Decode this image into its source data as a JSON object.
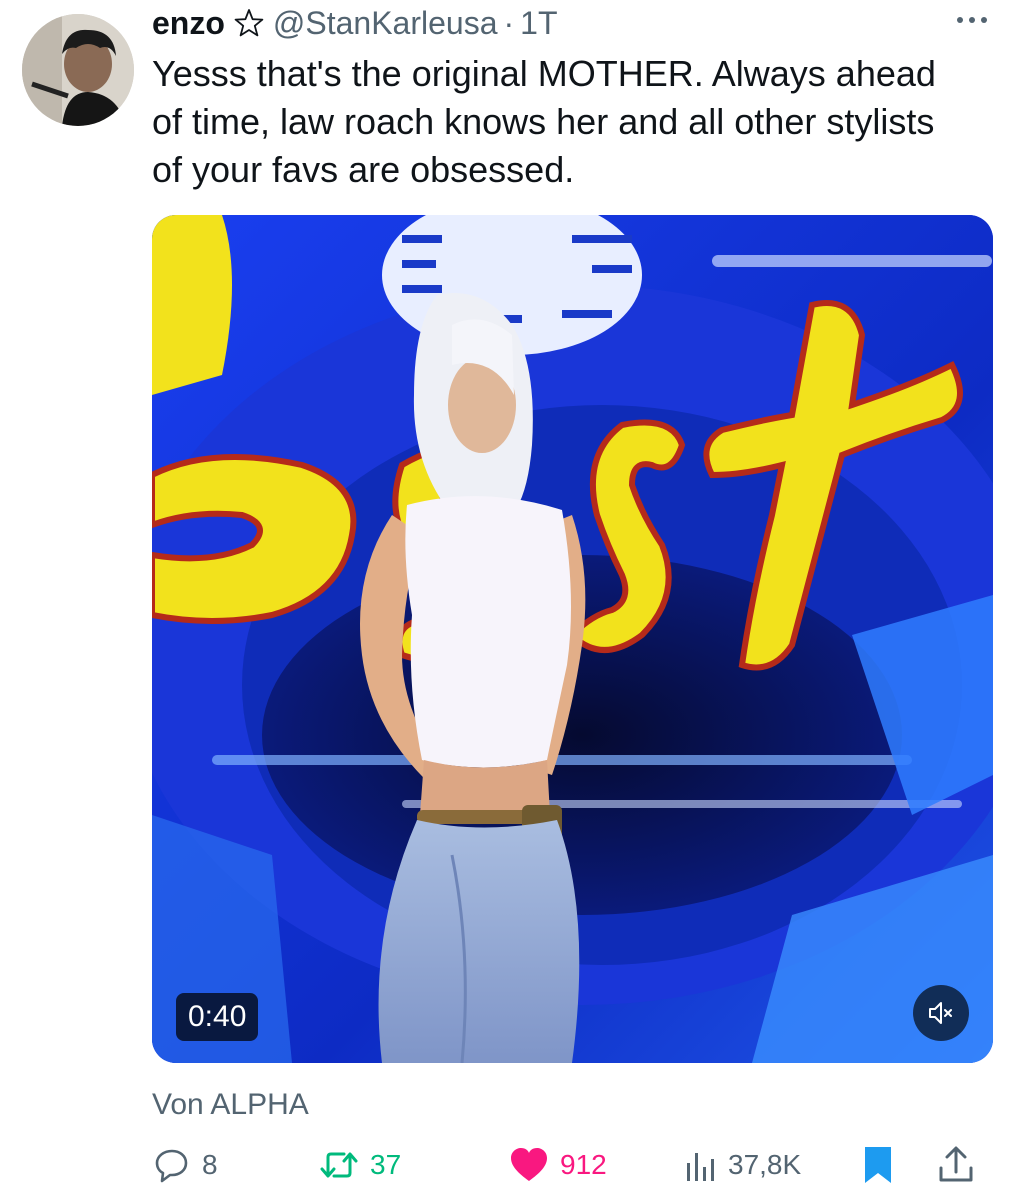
{
  "post": {
    "author_name": "enzo",
    "handle": "@StanKarleusa",
    "separator": "·",
    "time": "1T",
    "text_lines": [
      "Yesss that's the original MOTHER. Always ahead",
      "of time, law roach knows her and all other stylists",
      "of your favs are obsessed."
    ],
    "more_icon": "more-horizontal-icon",
    "star_icon": "star-outline-icon"
  },
  "media": {
    "duration": "0:40",
    "mute_icon": "volume-muted-icon",
    "source": "Von ALPHA"
  },
  "actions": {
    "reply_count": "8",
    "retweet_count": "37",
    "like_count": "912",
    "view_count": "37,8K",
    "reply_icon": "reply-bubble-icon",
    "retweet_icon": "retweet-icon",
    "like_icon": "heart-filled-icon",
    "views_icon": "bar-chart-icon",
    "bookmark_icon": "bookmark-filled-icon",
    "share_icon": "share-upload-icon"
  },
  "colors": {
    "text": "#0f1419",
    "secondary": "#536471",
    "retweet": "#00ba7c",
    "like": "#f91880",
    "bookmark": "#1d9bf0"
  }
}
